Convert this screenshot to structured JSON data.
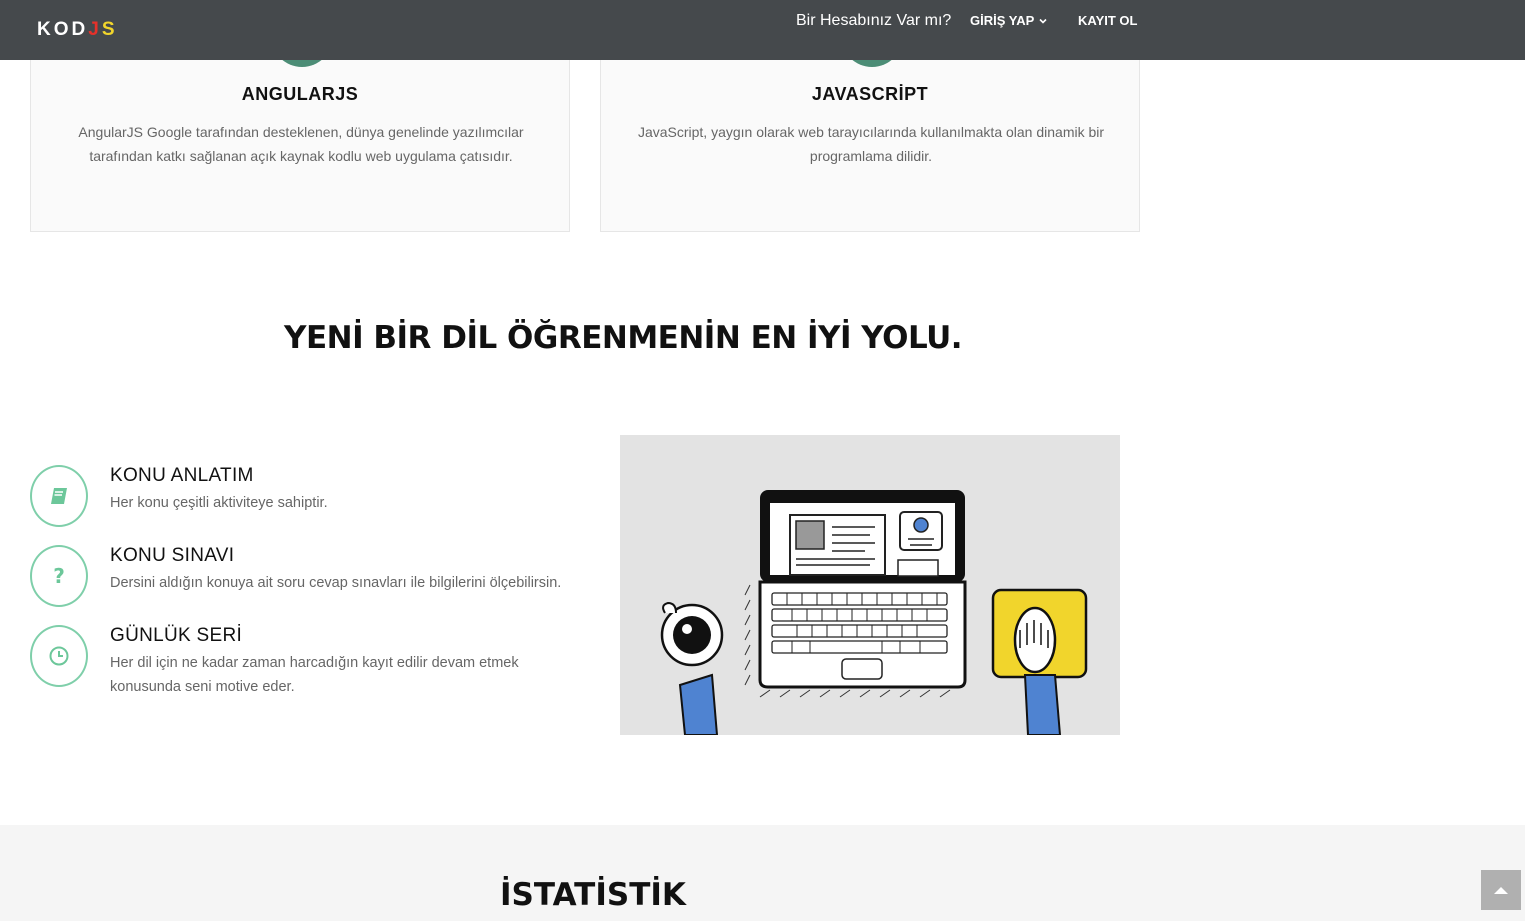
{
  "navbar": {
    "logo": {
      "part1": "KOD",
      "part2": "J",
      "part3": "S"
    },
    "question": "Bir Hesabınız Var mı?",
    "login_label": "GİRİŞ YAP",
    "register_label": "KAYIT OL"
  },
  "cards": [
    {
      "title": "ANGULARJS",
      "description": "AngularJS Google tarafından desteklenen, dünya genelinde yazılımcılar tarafından katkı sağlanan açık kaynak kodlu web uygulama çatısıdır.",
      "icon": "angular-icon"
    },
    {
      "title": "JAVASCRİPT",
      "description": "JavaScript, yaygın olarak web tarayıcılarında kullanılmakta olan dinamik bir programlama dilidir.",
      "icon": "javascript-icon"
    }
  ],
  "section": {
    "title": "YENİ BİR DİL ÖĞRENMENİN EN İYİ YOLU."
  },
  "features": [
    {
      "title": "KONU ANLATIM",
      "description": "Her konu çeşitli aktiviteye sahiptir.",
      "icon": "book-icon"
    },
    {
      "title": "KONU SINAVI",
      "description": "Dersini aldığın konuya ait soru cevap sınavları ile bilgilerini ölçebilirsin.",
      "icon": "question-icon",
      "icon_glyph": "?"
    },
    {
      "title": "GÜNLÜK SERİ",
      "description": "Her dil için ne kadar zaman harcadığın kayıt edilir devam etmek konusunda seni motive eder.",
      "icon": "clock-icon"
    }
  ],
  "stats": {
    "title": "İSTATİSTİK"
  },
  "colors": {
    "navbar": "#45494c",
    "accent_green": "#6cc79a",
    "card_bg": "#fafafa",
    "logo_red": "#e5312a",
    "logo_yellow": "#f1d52c"
  }
}
